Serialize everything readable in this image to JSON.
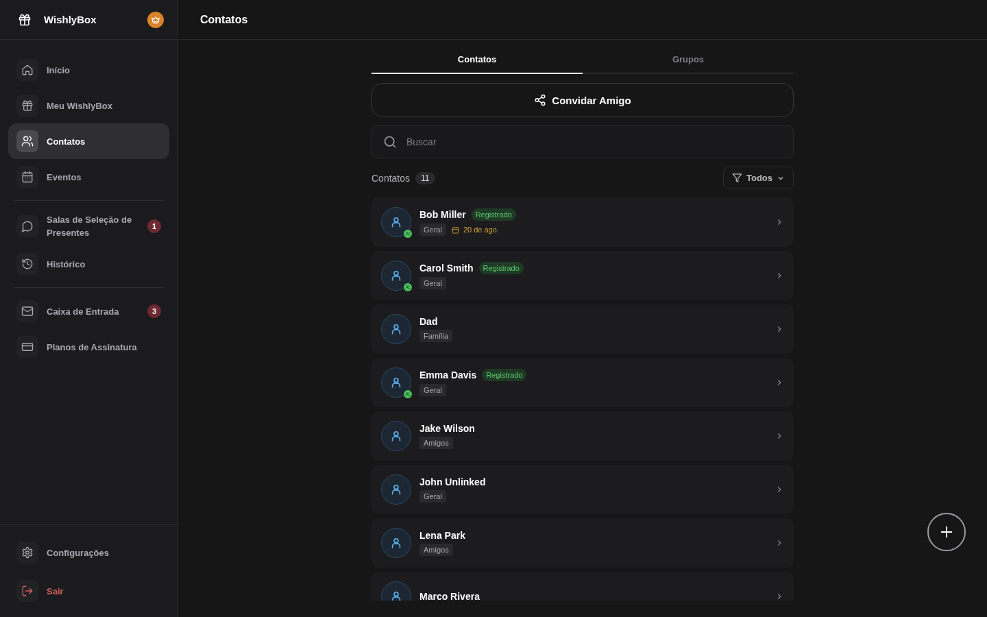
{
  "sidebar": {
    "brand": "WishlyBox",
    "nav_groups": [
      [
        {
          "label": "Início",
          "selected": false
        },
        {
          "label": "Meu WishlyBox",
          "selected": false
        },
        {
          "label": "Contatos",
          "selected": true
        },
        {
          "label": "Eventos",
          "selected": false
        }
      ],
      [
        {
          "label": "Salas de Seleção de Presentes",
          "selected": false,
          "badge": "1"
        },
        {
          "label": "Histórico",
          "selected": false
        }
      ],
      [
        {
          "label": "Caixa de Entrada",
          "selected": false,
          "badge": "3"
        },
        {
          "label": "Planos de Assinatura",
          "selected": false
        }
      ]
    ],
    "footer": [
      {
        "label": "Configurações",
        "kind": "normal"
      },
      {
        "label": "Sair",
        "kind": "danger"
      }
    ]
  },
  "header": {
    "title": "Contatos"
  },
  "tabs": [
    {
      "label": "Contatos",
      "selected": true
    },
    {
      "label": "Grupos",
      "selected": false
    }
  ],
  "invite_button": "Convidar Amigo",
  "search": {
    "placeholder": "Buscar"
  },
  "list_header": {
    "label": "Contatos",
    "count": "11",
    "filter": "Todos"
  },
  "contacts": [
    {
      "name": "Bob Miller",
      "status": "Registrado",
      "tag": "Geral",
      "date": "20 de ago."
    },
    {
      "name": "Carol Smith",
      "status": "Registrado",
      "tag": "Geral"
    },
    {
      "name": "Dad",
      "tag": "Família"
    },
    {
      "name": "Emma Davis",
      "status": "Registrado",
      "tag": "Geral"
    },
    {
      "name": "Jake Wilson",
      "tag": "Amigos"
    },
    {
      "name": "John Unlinked",
      "tag": "Geral"
    },
    {
      "name": "Lena Park",
      "tag": "Amigos"
    },
    {
      "name": "Marco Rivera"
    }
  ]
}
